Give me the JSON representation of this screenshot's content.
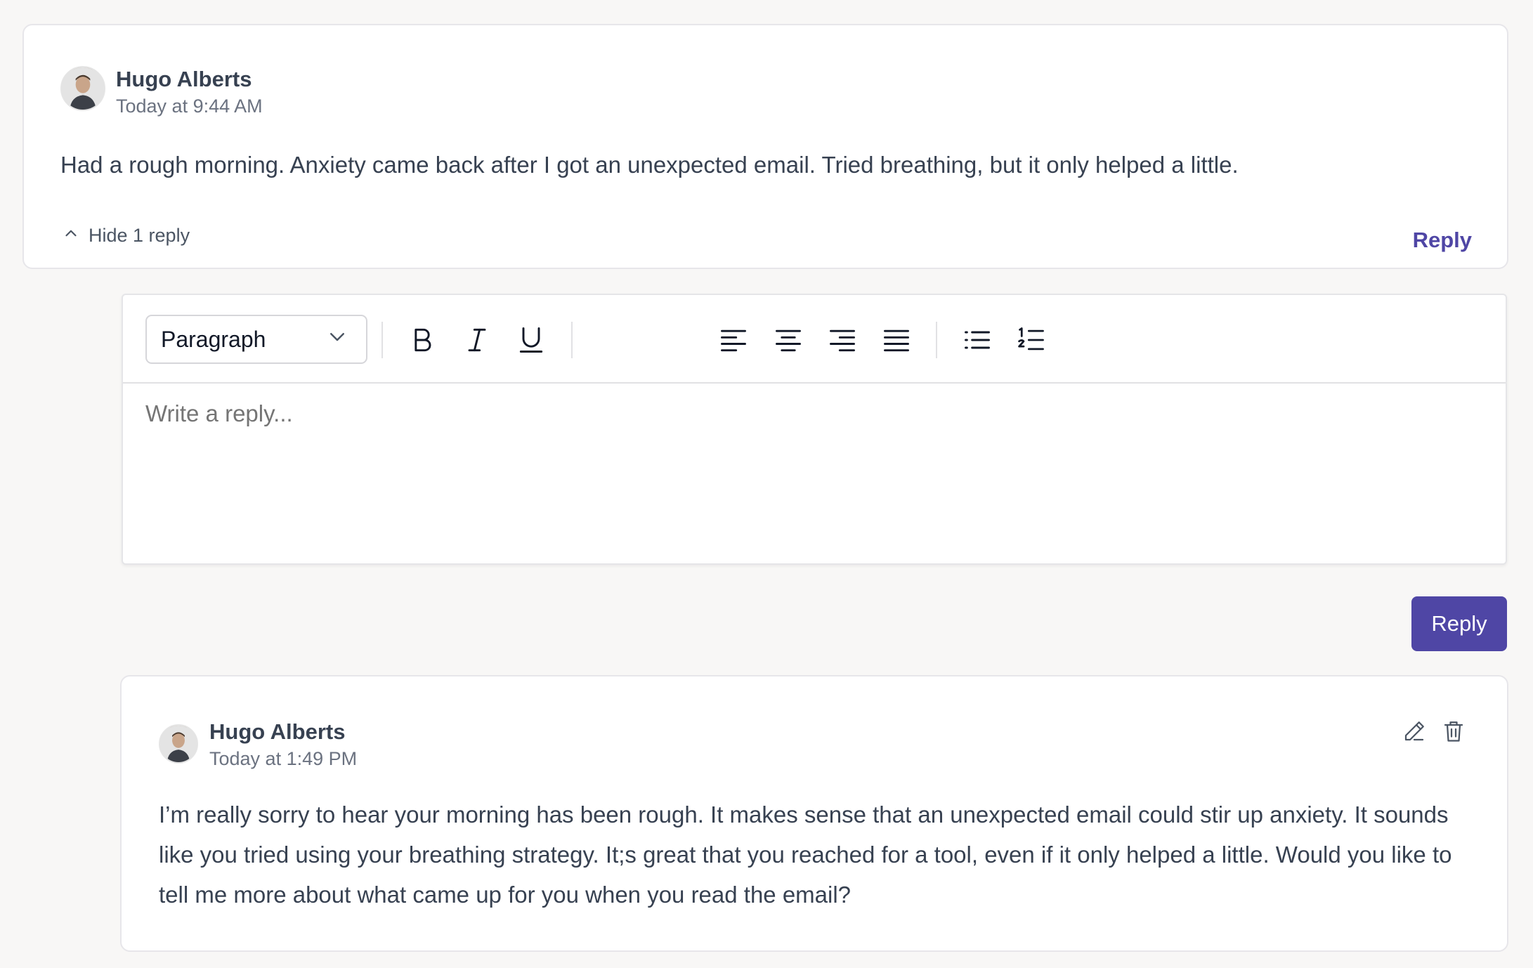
{
  "comment": {
    "author": "Hugo Alberts",
    "timestamp": "Today at 9:44 AM",
    "text": "Had a rough morning. Anxiety came back after I got an unexpected email. Tried breathing, but it only helped a little.",
    "hide_replies_label": "Hide 1 reply",
    "reply_link_label": "Reply"
  },
  "editor": {
    "block_type": "Paragraph",
    "placeholder": "Write a reply...",
    "toolbar_icons": [
      "bold-icon",
      "italic-icon",
      "underline-icon",
      "align-left-icon",
      "align-center-icon",
      "align-right-icon",
      "align-justify-icon",
      "bullet-list-icon",
      "numbered-list-icon"
    ],
    "submit_label": "Reply"
  },
  "reply": {
    "author": "Hugo Alberts",
    "timestamp": "Today at 1:49 PM",
    "text": "I’m really sorry to hear your morning has been rough. It makes sense that an unexpected email could stir up anxiety. It sounds like you tried using your breathing strategy. It;s great that you reached for a tool, even if it only helped a little. Would you like to tell me more about what came up for you when you read the email?",
    "actions": [
      "edit-icon",
      "delete-icon"
    ]
  },
  "colors": {
    "accent": "#4f46a5",
    "background": "#f8f7f6",
    "card": "#ffffff",
    "text": "#374151",
    "muted": "#6b7280",
    "placeholder": "#9ca3af"
  }
}
